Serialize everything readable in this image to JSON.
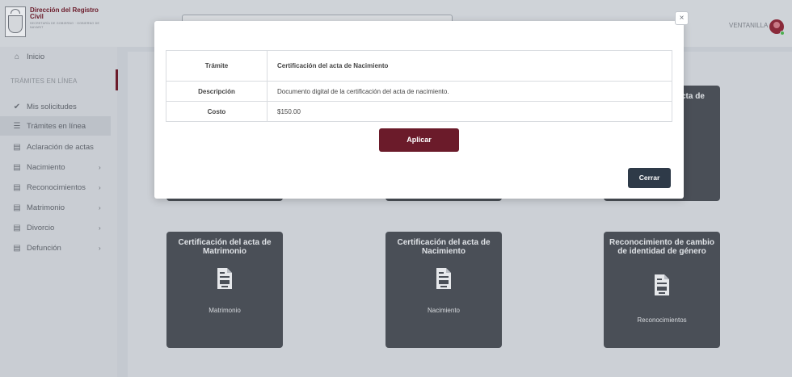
{
  "header": {
    "logo_title": "Dirección del Registro Civil",
    "logo_subtitle": "SECRETARÍA DE GOBIERNO · GOBIERNO DE NAYARIT",
    "user_name": "VENTANILLA"
  },
  "sidebar": {
    "section": "TRÁMITES EN LÍNEA",
    "items": [
      {
        "label": "Inicio",
        "icon": "home-icon"
      },
      {
        "label": "Mis solicitudes",
        "icon": "check-icon"
      },
      {
        "label": "Trámites en línea",
        "icon": "list-icon"
      },
      {
        "label": "Aclaración de actas",
        "icon": "document-icon"
      },
      {
        "label": "Nacimiento",
        "icon": "document-icon"
      },
      {
        "label": "Reconocimientos",
        "icon": "document-icon"
      },
      {
        "label": "Matrimonio",
        "icon": "document-icon"
      },
      {
        "label": "Divorcio",
        "icon": "document-icon"
      },
      {
        "label": "Defunción",
        "icon": "document-icon"
      }
    ]
  },
  "cards": [
    {
      "title": "Certificación del acta de Matrimonio",
      "label": "Matrimonio"
    },
    {
      "title": "Certificación del acta de Nacimiento",
      "label": "Nacimiento"
    },
    {
      "title": "Reconocimiento de cambio de identidad de género",
      "label": "Reconocimientos"
    }
  ],
  "partial_card_title": "cta de",
  "modal": {
    "rows": [
      {
        "label": "Trámite",
        "value": "Certificación del acta de Nacimiento"
      },
      {
        "label": "Descripción",
        "value": "Documento digital de la certificación del acta de nacimiento."
      },
      {
        "label": "Costo",
        "value": "$150.00"
      }
    ],
    "apply_label": "Aplicar",
    "close_label": "Cerrar",
    "close_x": "×"
  },
  "colors": {
    "brand": "#6b1b2a",
    "card": "#4a4f57",
    "close_button": "#2e3a48"
  }
}
